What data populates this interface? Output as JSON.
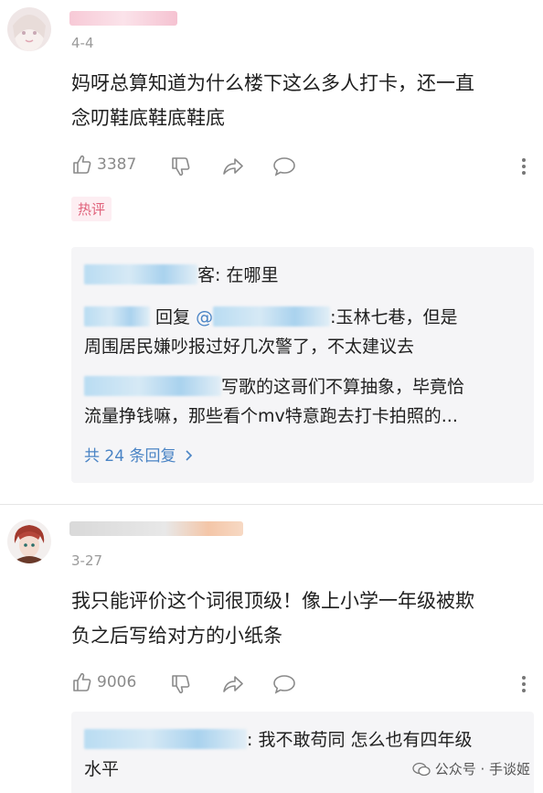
{
  "comments": [
    {
      "date": "4-4",
      "body_line1": "妈呀总算知道为什么楼下这么多人打卡，还一直",
      "body_line2": "念叨鞋底鞋底鞋底",
      "like_count": "3387",
      "hot_tag": "热评",
      "replies": [
        {
          "suffix": "客: 在哪里"
        },
        {
          "reply_word": "回复",
          "at": "@",
          "text": ":玉林七巷，但是",
          "text2": "周围居民嫌吵报过好几次警了，不太建议去"
        },
        {
          "text": "写歌的这哥们不算抽象，毕竟恰",
          "text2": "流量挣钱嘛，那些看个mv特意跑去打卡拍照的..."
        }
      ],
      "more_replies": "共 24 条回复"
    },
    {
      "date": "3-27",
      "body_line1": "我只能评价这个词很顶级！像上小学一年级被欺",
      "body_line2": "负之后写给对方的小纸条",
      "like_count": "9006",
      "replies": [
        {
          "text": ": 我不敢苟同 怎么也有四年级",
          "text2": "水平"
        }
      ]
    }
  ],
  "watermark": {
    "text": "公众号 · 手谈姬"
  },
  "icons": [
    "thumb-up-icon",
    "thumb-down-icon",
    "share-icon",
    "comment-icon",
    "more-icon",
    "chevron-right-icon",
    "wechat-icon"
  ]
}
